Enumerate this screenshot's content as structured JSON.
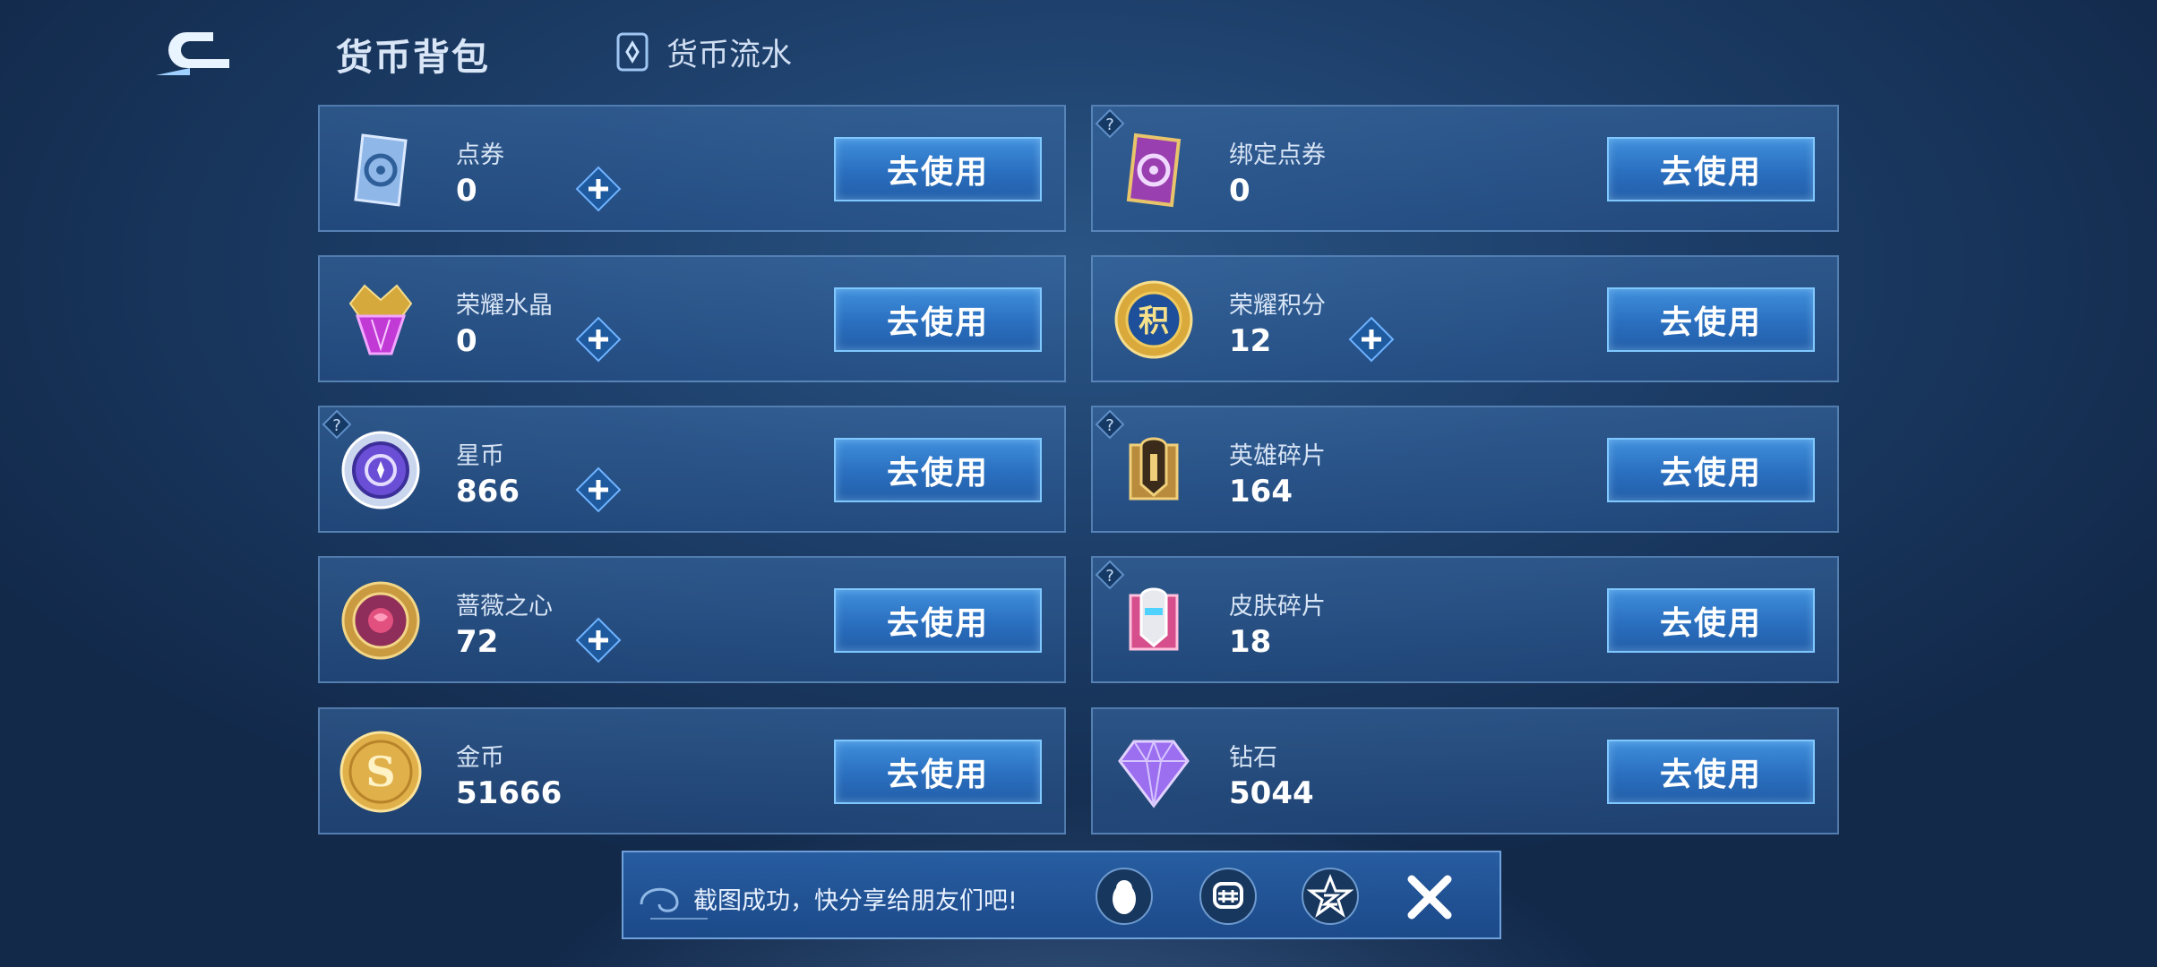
{
  "header": {
    "title": "货币背包",
    "flow_tab": "货币流水"
  },
  "currencies": [
    {
      "name": "点券",
      "amount": "0",
      "button": "去使用"
    },
    {
      "name": "绑定点券",
      "amount": "0",
      "button": "去使用"
    },
    {
      "name": "荣耀水晶",
      "amount": "0",
      "button": "去使用"
    },
    {
      "name": "荣耀积分",
      "amount": "12",
      "button": "去使用"
    },
    {
      "name": "星币",
      "amount": "866",
      "button": "去使用"
    },
    {
      "name": "英雄碎片",
      "amount": "164",
      "button": "去使用"
    },
    {
      "name": "蔷薇之心",
      "amount": "72",
      "button": "去使用"
    },
    {
      "name": "皮肤碎片",
      "amount": "18",
      "button": "去使用"
    },
    {
      "name": "金币",
      "amount": "51666",
      "button": "去使用"
    },
    {
      "name": "钻石",
      "amount": "5044",
      "button": "去使用"
    }
  ],
  "toast": {
    "message": "截图成功，快分享给朋友们吧!"
  },
  "icons": {
    "back": "back-arrow-icon",
    "flow": "flow-card-icon",
    "plus": "plus-icon",
    "help": "question-icon",
    "qq": "qq-penguin-icon",
    "wechat": "wechat-icon",
    "qzone": "qzone-star-icon",
    "close": "close-icon"
  },
  "colors": {
    "button": "#2a6fbf",
    "button_border": "#7fc8ff",
    "card_bg": "#2e5f96",
    "text": "#ffffff"
  }
}
